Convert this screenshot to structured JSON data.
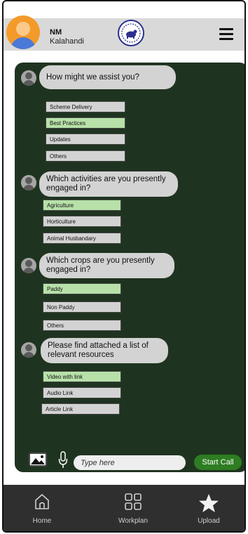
{
  "header": {
    "user_name": "NM",
    "user_location": "Kalahandi"
  },
  "chat": {
    "q1": {
      "question": "How might we assist you?",
      "options": [
        {
          "label": "Scheme Delivery",
          "selected": false
        },
        {
          "label": "Best Practices",
          "selected": true
        },
        {
          "label": "Updates",
          "selected": false
        },
        {
          "label": "Others",
          "selected": false
        }
      ]
    },
    "q2": {
      "question": "Which activities are you presently engaged in?",
      "options": [
        {
          "label": "Agriculture",
          "selected": true
        },
        {
          "label": "Horticulture",
          "selected": false
        },
        {
          "label": "Animal Husbandary",
          "selected": false
        }
      ]
    },
    "q3": {
      "question": "Which crops are you presently engaged in?",
      "options": [
        {
          "label": "Paddy",
          "selected": true
        },
        {
          "label": "Non Paddy",
          "selected": false
        },
        {
          "label": "Others",
          "selected": false
        }
      ]
    },
    "q4": {
      "question": "Please find attached a list of relevant resources",
      "options": [
        {
          "label": "Video with link",
          "selected": true
        },
        {
          "label": "Audio Link",
          "selected": false
        },
        {
          "label": "Article Link",
          "selected": false
        }
      ]
    }
  },
  "composer": {
    "placeholder": "Type here",
    "start_call_label": "Start Call"
  },
  "nav": {
    "items": [
      {
        "label": "Home",
        "icon": "home-icon"
      },
      {
        "label": "Workplan",
        "icon": "grid-icon"
      },
      {
        "label": "Upload",
        "icon": "star-icon"
      }
    ]
  },
  "colors": {
    "chat_bg": "#1f3420",
    "selected_option": "#b7e1a8",
    "start_call": "#2e7d22",
    "nav_bg": "#2f2f2f"
  }
}
